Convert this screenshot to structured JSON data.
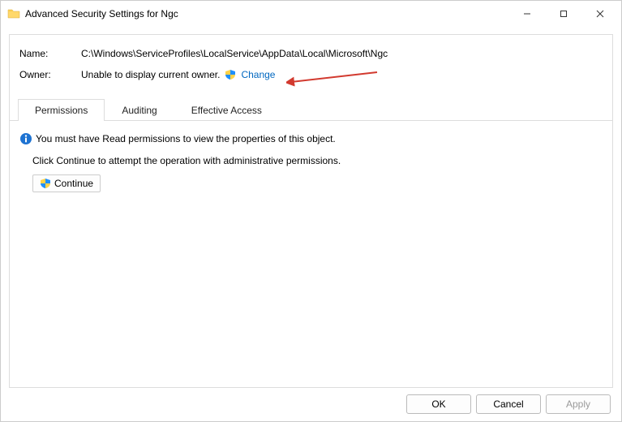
{
  "window": {
    "title": "Advanced Security Settings for Ngc"
  },
  "fields": {
    "name_label": "Name:",
    "name_value": "C:\\Windows\\ServiceProfiles\\LocalService\\AppData\\Local\\Microsoft\\Ngc",
    "owner_label": "Owner:",
    "owner_value": "Unable to display current owner.",
    "change_link": "Change"
  },
  "tabs": {
    "permissions": "Permissions",
    "auditing": "Auditing",
    "effective": "Effective Access"
  },
  "messages": {
    "need_read": "You must have Read permissions to view the properties of this object.",
    "click_continue": "Click Continue to attempt the operation with administrative permissions."
  },
  "buttons": {
    "continue": "Continue",
    "ok": "OK",
    "cancel": "Cancel",
    "apply": "Apply"
  }
}
